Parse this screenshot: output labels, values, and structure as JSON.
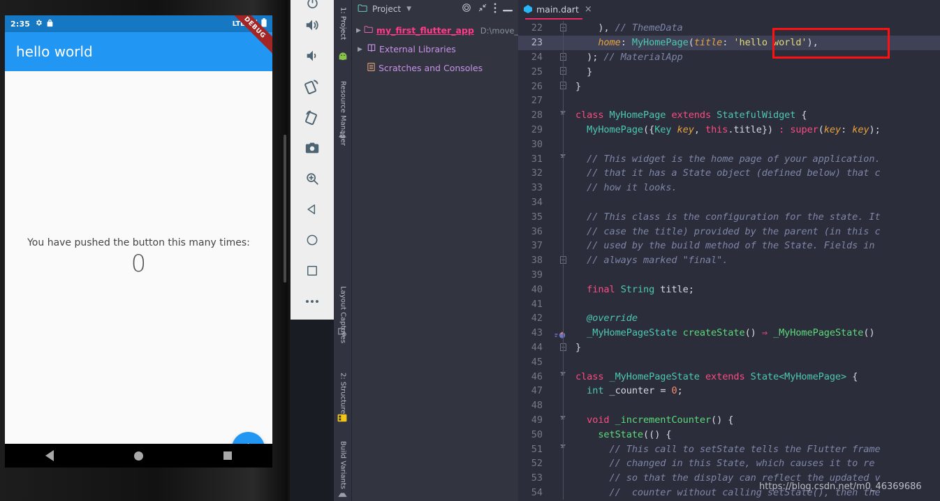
{
  "emulator": {
    "phone": {
      "status_bar": {
        "time": "2:35",
        "icons_left": [
          "gear-icon",
          "lock-icon"
        ],
        "network": "LTE",
        "icons_right": [
          "signal-icon",
          "battery-icon"
        ]
      },
      "appbar_title": "hello world",
      "debug_banner": "DEBUG",
      "body": {
        "label": "You have pushed the button this many times:",
        "counter": "0"
      },
      "fab_label": "+",
      "nav_buttons": [
        "back-button",
        "home-button",
        "recents-button"
      ]
    },
    "toolbar_buttons": [
      {
        "name": "power-button",
        "icon": "power-icon"
      },
      {
        "name": "volume-up-button",
        "icon": "volume-up-icon"
      },
      {
        "name": "volume-down-button",
        "icon": "volume-down-icon"
      },
      {
        "name": "rotate-left-button",
        "icon": "rotate-left-icon"
      },
      {
        "name": "rotate-right-button",
        "icon": "rotate-right-icon"
      },
      {
        "name": "screenshot-button",
        "icon": "camera-icon"
      },
      {
        "name": "zoom-button",
        "icon": "zoom-in-icon"
      },
      {
        "name": "back-button",
        "icon": "triangle-back-icon"
      },
      {
        "name": "home-button",
        "icon": "circle-home-icon"
      },
      {
        "name": "overview-button",
        "icon": "square-overview-icon"
      },
      {
        "name": "more-button",
        "icon": "ellipsis-icon"
      }
    ]
  },
  "ide": {
    "tool_window_tabs": [
      {
        "label": "1: Project",
        "active": true
      },
      {
        "label": "Resource Manager",
        "active": false
      },
      {
        "label": "Layout Captures",
        "active": false
      },
      {
        "label": "2: Structure",
        "active": false
      },
      {
        "label": "Build Variants",
        "active": false
      }
    ],
    "project_panel": {
      "title": "Project",
      "header_icons": [
        "chevron-down-icon",
        "target-icon",
        "collapse-all-icon",
        "options-icon",
        "hide-icon"
      ],
      "tree": [
        {
          "label": "my_first_flutter_app",
          "path": "D:\\move_c",
          "kind": "project",
          "expandable": true
        },
        {
          "label": "External Libraries",
          "path": "",
          "kind": "libraries",
          "expandable": true
        },
        {
          "label": "Scratches and Consoles",
          "path": "",
          "kind": "scratches",
          "expandable": false
        }
      ]
    },
    "editor": {
      "tab": {
        "filename": "main.dart",
        "icon": "dart-file-icon",
        "close": "×"
      },
      "highlight_annotation": "red-rectangle-around-hello-world-string",
      "lines": [
        {
          "n": "22",
          "fold": "square",
          "html": "    <span class=\"nm\">)</span><span class=\"nm\">,</span> <span class=\"cm\">// ThemeData</span>"
        },
        {
          "n": "23",
          "fold": "none",
          "highlight": true,
          "html": "    <span class=\"pa\">home</span><span class=\"nm\">:</span> <span class=\"ty\">MyHomePage</span><span class=\"nm\">(</span><span class=\"pa\">title</span><span class=\"nm\">:</span> <span class=\"st\">'hello world'</span><span class=\"nm\">),</span>"
        },
        {
          "n": "24",
          "fold": "square",
          "html": "  <span class=\"nm\">);</span> <span class=\"cm\">// MaterialApp</span>"
        },
        {
          "n": "25",
          "fold": "square",
          "html": "  <span class=\"nm\">}</span>"
        },
        {
          "n": "26",
          "fold": "square",
          "html": "<span class=\"nm\">}</span>"
        },
        {
          "n": "27",
          "fold": "none",
          "html": ""
        },
        {
          "n": "28",
          "fold": "tri",
          "html": "<span class=\"k\">class</span> <span class=\"ty\">MyHomePage</span> <span class=\"k\">extends</span> <span class=\"ty\">StatefulWidget</span> <span class=\"nm\">{</span>"
        },
        {
          "n": "29",
          "fold": "none",
          "html": "  <span class=\"ty\">MyHomePage</span><span class=\"nm\">({</span><span class=\"ty\">Key</span> <span class=\"pa\">key</span><span class=\"nm\">,</span> <span class=\"k\">this</span><span class=\"nm\">.title})</span> <span class=\"op\">:</span> <span class=\"k\">super</span><span class=\"nm\">(</span><span class=\"pa\">key</span><span class=\"nm\">:</span> <span class=\"pa\">key</span><span class=\"nm\">);</span>"
        },
        {
          "n": "30",
          "fold": "none",
          "html": ""
        },
        {
          "n": "31",
          "fold": "tri",
          "html": "  <span class=\"cm\">// This widget is the home page of your application.</span>"
        },
        {
          "n": "32",
          "fold": "none",
          "html": "  <span class=\"cm\">// that it has a State object (defined below) that c</span>"
        },
        {
          "n": "33",
          "fold": "none",
          "html": "  <span class=\"cm\">// how it looks.</span>"
        },
        {
          "n": "34",
          "fold": "none",
          "html": ""
        },
        {
          "n": "35",
          "fold": "none",
          "html": "  <span class=\"cm\">// This class is the configuration for the state. It</span>"
        },
        {
          "n": "36",
          "fold": "none",
          "html": "  <span class=\"cm\">// case the title) provided by the parent (in this c</span>"
        },
        {
          "n": "37",
          "fold": "none",
          "html": "  <span class=\"cm\">// used by the build method of the State. Fields in </span>"
        },
        {
          "n": "38",
          "fold": "square",
          "html": "  <span class=\"cm\">// always marked \"final\".</span>"
        },
        {
          "n": "39",
          "fold": "none",
          "html": ""
        },
        {
          "n": "40",
          "fold": "none",
          "html": "  <span class=\"k\">final</span> <span class=\"ty\">String</span> <span class=\"nm\">title;</span>"
        },
        {
          "n": "41",
          "fold": "none",
          "html": ""
        },
        {
          "n": "42",
          "fold": "none",
          "html": "  <span class=\"ty\" style=\"font-style:italic\">@override</span>"
        },
        {
          "n": "43",
          "fold": "none",
          "override": true,
          "html": "  <span class=\"ty\">_MyHomePageState</span> <span class=\"fn\">createState</span><span class=\"nm\">()</span> <span class=\"op\">⇒</span> <span class=\"fn\">_MyHomePageState</span><span class=\"nm\">()</span>"
        },
        {
          "n": "44",
          "fold": "square",
          "html": "<span class=\"nm\">}</span>"
        },
        {
          "n": "45",
          "fold": "none",
          "html": ""
        },
        {
          "n": "46",
          "fold": "tri",
          "html": "<span class=\"k\">class</span> <span class=\"ty\">_MyHomePageState</span> <span class=\"k\">extends</span> <span class=\"ty\">State&lt;MyHomePage&gt;</span> <span class=\"nm\">{</span>"
        },
        {
          "n": "47",
          "fold": "none",
          "html": "  <span class=\"ty\">int</span> <span class=\"nm\">_counter</span> <span class=\"nm\">=</span> <span class=\"num\">0</span><span class=\"nm\">;</span>"
        },
        {
          "n": "48",
          "fold": "none",
          "html": ""
        },
        {
          "n": "49",
          "fold": "tri",
          "html": "  <span class=\"k\">void</span> <span class=\"fn\">_incrementCounter</span><span class=\"nm\">() {</span>"
        },
        {
          "n": "50",
          "fold": "none",
          "html": "    <span class=\"fn\">setState</span><span class=\"nm\">(() {</span>"
        },
        {
          "n": "51",
          "fold": "tri",
          "html": "      <span class=\"cm\">// This call to setState tells the Flutter frame</span>"
        },
        {
          "n": "52",
          "fold": "none",
          "html": "      <span class=\"cm\">// changed in this State, which causes it to re</span>"
        },
        {
          "n": "53",
          "fold": "none",
          "html": "      <span class=\"cm\">// so that the display can reflect the updated v</span>"
        },
        {
          "n": "54",
          "fold": "none",
          "html": "      <span class=\"cm\">//  counter without calling setState(), then the</span>"
        }
      ]
    }
  },
  "watermark": "https://blog.csdn.net/m0_46369686",
  "colors": {
    "appbar_blue": "#2196f3",
    "status_blue": "#1678c2",
    "debug_red": "#a32525",
    "ide_bg": "#2b2d3a",
    "panel_bg": "#32343f",
    "highlight_red": "#ff1111",
    "project_pink": "#ff3b8a"
  }
}
